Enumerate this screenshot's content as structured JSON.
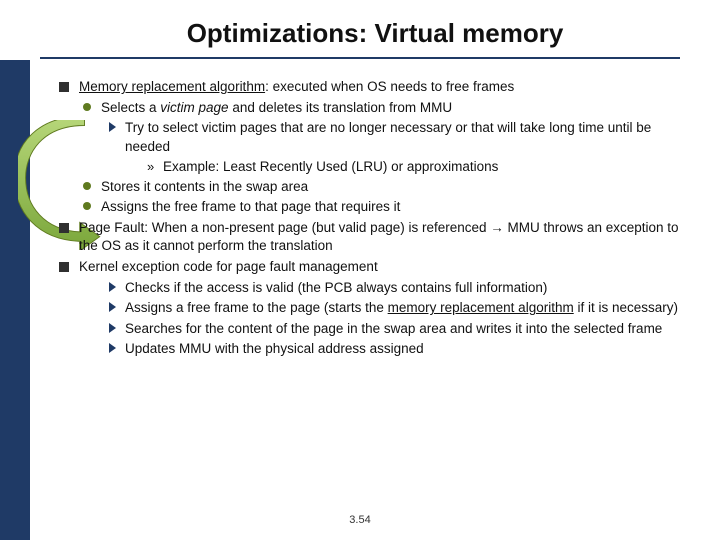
{
  "title": "Optimizations: Virtual memory",
  "b1": {
    "lead": "Memory replacement algorithm",
    "rest": ": executed when OS needs to free frames"
  },
  "b1_1a": "Selects a ",
  "b1_1b": "victim page",
  "b1_1c": " and deletes its translation from MMU",
  "b1_1_1": "Try to select victim pages that are no longer necessary or that  will take long time until be needed",
  "b1_1_1_1": "Example: Least Recently Used (LRU) or approximations",
  "b1_2": "Stores it contents in the swap area",
  "b1_3": "Assigns the free frame to that page that requires it",
  "b2": "Page Fault: When a non-present page (but valid page) is referenced → MMU throws an exception to the OS as it cannot perform the translation",
  "b3": "Kernel exception code for page fault management",
  "b3_1": "Checks if the access is valid (the PCB always contains full information)",
  "b3_2a": "Assigns a free frame to the page (starts the ",
  "b3_2b": "memory replacement algorithm",
  "b3_2c": " if it is necessary)",
  "b3_3": "Searches for the content of the page in the swap area  and writes it into the selected frame",
  "b3_4": "Updates MMU with the physical address assigned",
  "pagenum": "3.54"
}
